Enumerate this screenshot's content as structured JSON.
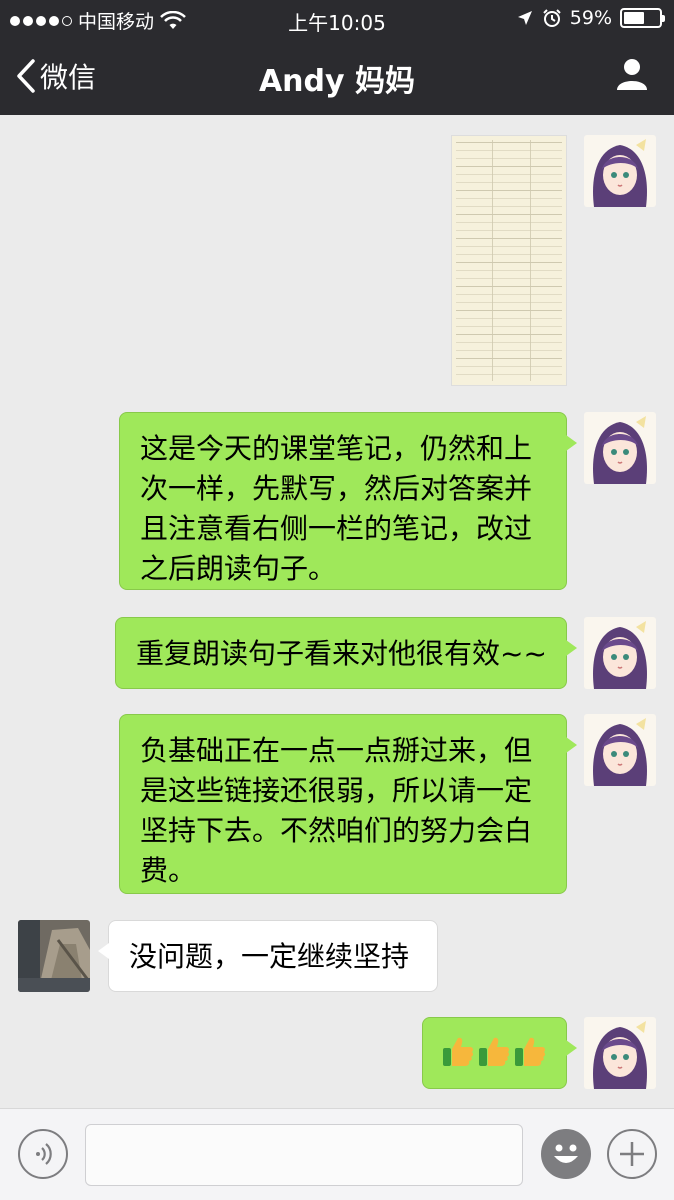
{
  "status_bar": {
    "carrier": "中国移动",
    "time": "上午10:05",
    "battery_text": "59%",
    "battery_level": 0.59
  },
  "nav": {
    "back_label": "微信",
    "title": "Andy 妈妈"
  },
  "messages": [
    {
      "type": "image",
      "sender": "me"
    },
    {
      "type": "text",
      "sender": "me",
      "text": "这是今天的课堂笔记，仍然和上次一样，先默写，然后对答案并且注意看右侧一栏的笔记，改过之后朗读句子。"
    },
    {
      "type": "text",
      "sender": "me",
      "text": "重复朗读句子看来对他很有效~~"
    },
    {
      "type": "text",
      "sender": "me",
      "text": "负基础正在一点一点掰过来，但是这些链接还很弱，所以请一定坚持下去。不然咱们的努力会白费。"
    },
    {
      "type": "text",
      "sender": "friend",
      "text": "没问题，一定继续坚持"
    },
    {
      "type": "emoji",
      "sender": "me",
      "emoji": "👍👍👍"
    }
  ],
  "icons": {
    "back": "chevron-left-icon",
    "user": "user-icon",
    "voice": "voice-icon",
    "emoji": "smiley-icon",
    "plus": "plus-icon"
  },
  "colors": {
    "bar": "#2b2b2f",
    "chat_bg": "#ebebeb",
    "bubble_out": "#9fe85a",
    "bubble_in": "#ffffff"
  }
}
